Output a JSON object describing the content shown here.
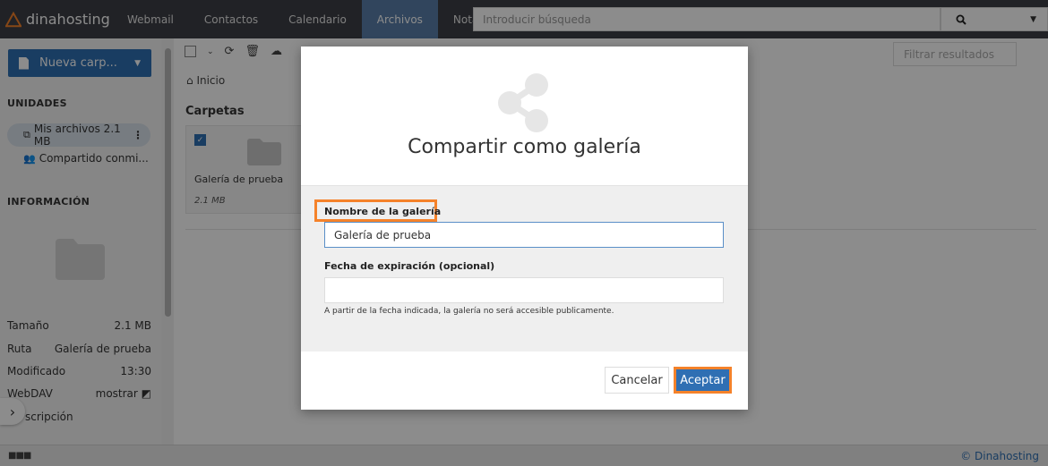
{
  "app": {
    "brand": "dinahosting"
  },
  "nav": {
    "items": [
      "Webmail",
      "Contactos",
      "Calendario",
      "Archivos",
      "Notas"
    ],
    "active": "Archivos"
  },
  "search": {
    "placeholder": "Introducir búsqueda"
  },
  "sidebar": {
    "new_folder_label": "Nueva carp...",
    "units_title": "UNIDADES",
    "units": [
      {
        "label": "Mis archivos 2.1 MB",
        "icon": "copy-icon"
      },
      {
        "label": "Compartido conmi...",
        "icon": "users-icon"
      }
    ],
    "info_title": "INFORMACIÓN",
    "info": [
      {
        "key": "Tamaño",
        "value": "2.1 MB"
      },
      {
        "key": "Ruta",
        "value": "Galería de prueba"
      },
      {
        "key": "Modificado",
        "value": "13:30"
      },
      {
        "key": "WebDAV",
        "value": "mostrar"
      },
      {
        "key": "scripción",
        "value": ""
      }
    ]
  },
  "main": {
    "filter_placeholder": "Filtrar resultados",
    "breadcrumb": "Inicio",
    "folders_title": "Carpetas",
    "folder": {
      "name": "Galería de prueba",
      "size": "2.1 MB"
    }
  },
  "footer": {
    "copyright": "© Dinahosting"
  },
  "modal": {
    "title": "Compartir como galería",
    "name_label": "Nombre de la galería",
    "name_value": "Galería de prueba",
    "expiry_label": "Fecha de expiración (opcional)",
    "expiry_value": "",
    "help": "A partir de la fecha indicada, la galería no será accesible publicamente.",
    "cancel_label": "Cancelar",
    "accept_label": "Aceptar"
  },
  "colors": {
    "topbar": "#3d3f45",
    "accent": "#2f6fb3",
    "highlight": "#f5822a"
  }
}
